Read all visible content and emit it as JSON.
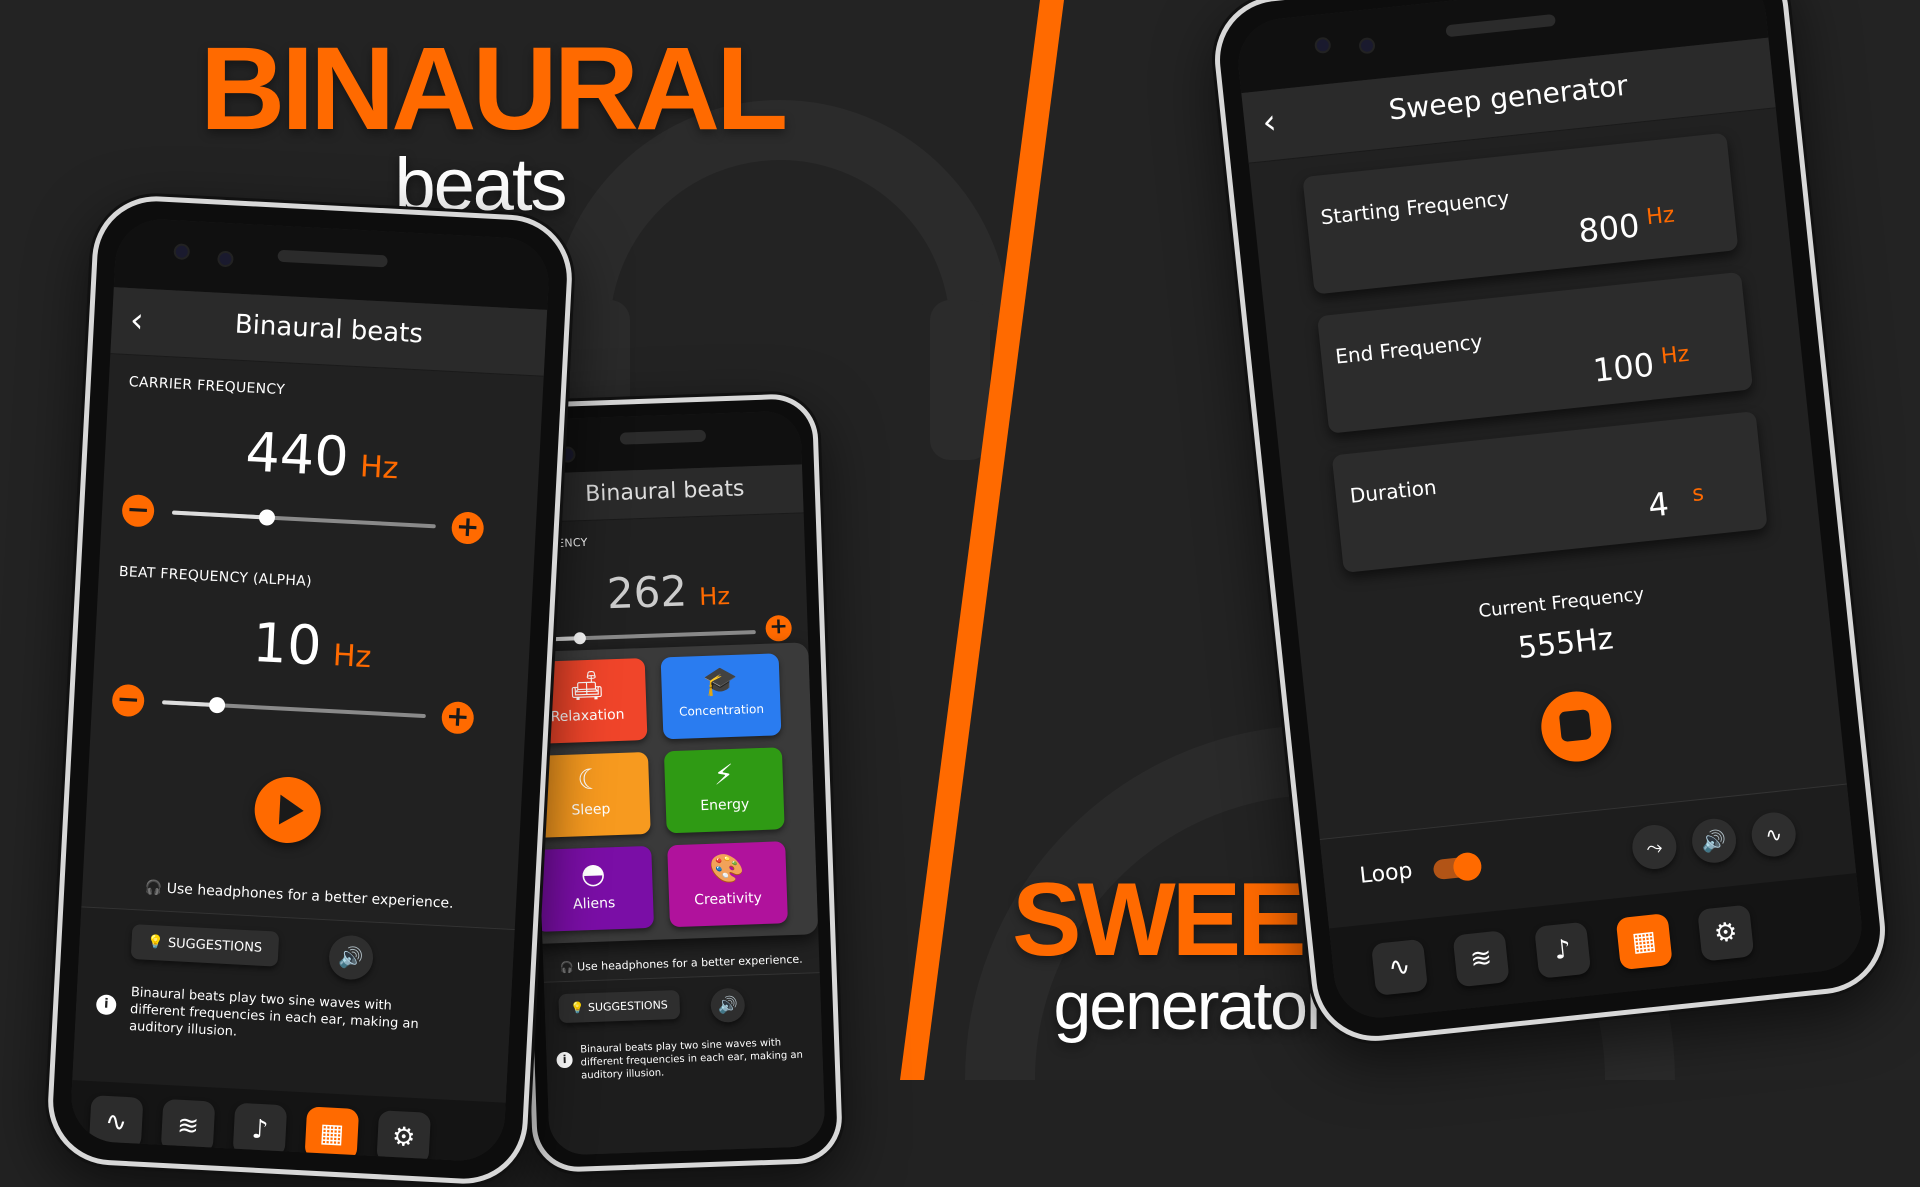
{
  "colors": {
    "accent": "#ff6a00",
    "background": "#222222",
    "panel": "#2c2c2c"
  },
  "headline_left": {
    "main": "BINAURAL",
    "sub": "beats"
  },
  "headline_right": {
    "main": "SWEEP",
    "sub": "generator"
  },
  "binaural_main": {
    "title": "Binaural beats",
    "carrier_label": "CARRIER FREQUENCY",
    "carrier_value": "440",
    "carrier_unit": "Hz",
    "carrier_slider_fraction": 0.36,
    "beat_label": "BEAT FREQUENCY (ALPHA)",
    "beat_value": "10",
    "beat_unit": "Hz",
    "beat_slider_fraction": 0.21,
    "headphone_note": "Use headphones for a better experience.",
    "suggestions_label": "SUGGESTIONS",
    "info_text": "Binaural beats play two sine waves with different frequencies in each ear, making an auditory illusion."
  },
  "binaural_back": {
    "title": "Binaural beats",
    "carrier_label_partial": "REQUENCY",
    "carrier_value": "262",
    "carrier_unit": "Hz",
    "carrier_slider_fraction": 0.2,
    "headphone_note": "Use headphones for a better experience.",
    "suggestions_label": "SUGGESTIONS",
    "info_text": "Binaural beats play two sine waves with different frequencies in each ear, making an auditory illusion.",
    "tiles": [
      {
        "label": "Relaxation",
        "icon": "sofa-icon",
        "color": "#f0452a"
      },
      {
        "label": "Concentration",
        "icon": "graduation-cap-icon",
        "color": "#2a7cf0"
      },
      {
        "label": "Sleep",
        "icon": "moon-icon",
        "color": "#f79a1f"
      },
      {
        "label": "Energy",
        "icon": "lightning-icon",
        "color": "#2f9a14"
      },
      {
        "label": "Aliens",
        "icon": "ufo-icon",
        "color": "#7a0ea6"
      },
      {
        "label": "Creativity",
        "icon": "palette-icon",
        "color": "#b0129c"
      }
    ]
  },
  "sweep": {
    "title": "Sweep generator",
    "start_label": "Starting Frequency",
    "start_value": "800",
    "start_unit": "Hz",
    "end_label": "End Frequency",
    "end_value": "100",
    "end_unit": "Hz",
    "duration_label": "Duration",
    "duration_value": "4",
    "duration_unit": "s",
    "current_label": "Current Frequency",
    "current_value": "555Hz",
    "loop_label": "Loop",
    "loop_on": true
  },
  "nav_icons": [
    "sine-wave-icon",
    "noise-wave-icon",
    "music-note-icon",
    "grid-icon",
    "settings-icon"
  ]
}
